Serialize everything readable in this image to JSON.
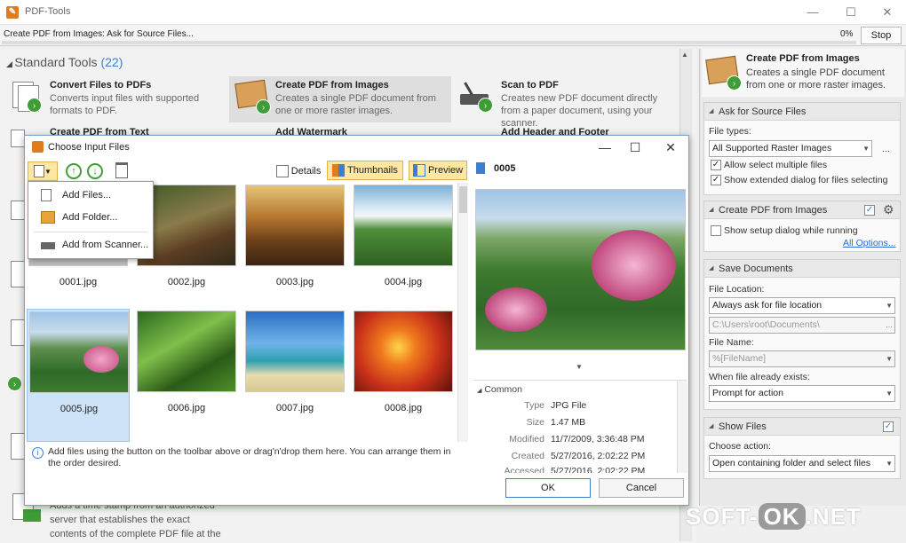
{
  "window": {
    "title": "PDF-Tools",
    "app_icon_glyph": "✎",
    "minimize": "—",
    "maximize": "☐",
    "close": "✕"
  },
  "progress": {
    "task": "Create PDF from Images: Ask for Source Files...",
    "percent": "0%",
    "value": 0,
    "stop_label": "Stop"
  },
  "tools": {
    "section_title": "Standard Tools",
    "count": "(22)",
    "items": [
      {
        "name": "Convert Files to PDFs",
        "desc": "Converts input files with supported formats to PDF."
      },
      {
        "name": "Create PDF from Images",
        "desc": "Creates a single PDF document from one or more raster images."
      },
      {
        "name": "Scan to PDF",
        "desc": "Creates new PDF document directly from a paper document, using your scanner."
      },
      {
        "name": "Create PDF from Text",
        "desc": ""
      },
      {
        "name": "Add Watermark",
        "desc": ""
      },
      {
        "name": "Add Header and Footer",
        "desc": ""
      }
    ],
    "bottom_desc": "Adds a time stamp from an authorized server that establishes the exact contents of the complete PDF file at the time the"
  },
  "right_panel": {
    "header_name": "Create PDF from Images",
    "header_desc": "Creates a single PDF document from one or more raster images.",
    "ask": {
      "title": "Ask for Source Files",
      "file_types_label": "File types:",
      "file_types_value": "All Supported Raster Images",
      "browse": "...",
      "allow_multiple": "Allow select multiple files",
      "extended_dialog": "Show extended dialog for files selecting"
    },
    "create": {
      "title": "Create PDF from Images",
      "show_setup": "Show setup dialog while running",
      "all_options": "All Options..."
    },
    "save": {
      "title": "Save Documents",
      "location_label": "File Location:",
      "location_value": "Always ask for file location",
      "path_value": "C:\\Users\\root\\Documents\\",
      "name_label": "File Name:",
      "name_value": "%[FileName]",
      "exists_label": "When file already exists:",
      "exists_value": "Prompt for action"
    },
    "show": {
      "title": "Show Files",
      "action_label": "Choose action:",
      "action_value": "Open containing folder and select files"
    }
  },
  "dialog": {
    "title": "Choose Input Files",
    "toolbar": {
      "details": "Details",
      "thumbnails": "Thumbnails",
      "preview": "Preview"
    },
    "menu": [
      "Add Files...",
      "Add Folder...",
      "Add from Scanner..."
    ],
    "files": [
      "0001.jpg",
      "0002.jpg",
      "0003.jpg",
      "0004.jpg",
      "0005.jpg",
      "0006.jpg",
      "0007.jpg",
      "0008.jpg"
    ],
    "selected_index": 4,
    "hint": "Add files using the button on the toolbar above or drag'n'drop them here. You can arrange them in the order desired.",
    "preview_name": "0005",
    "props_group": "Common",
    "props": [
      {
        "k": "Type",
        "v": "JPG File"
      },
      {
        "k": "Size",
        "v": "1.47 MB"
      },
      {
        "k": "Modified",
        "v": "11/7/2009, 3:36:48 PM"
      },
      {
        "k": "Created",
        "v": "5/27/2016, 2:02:22 PM"
      },
      {
        "k": "Accessed",
        "v": "5/27/2016, 2:02:22 PM"
      }
    ],
    "ok": "OK",
    "cancel": "Cancel"
  },
  "watermark": {
    "left": "SOFT-",
    "ok": "OK",
    "right": ".NET"
  },
  "colors": {
    "accent": "#3a7fd0",
    "green": "#3f9d36",
    "orange": "#e07b1f",
    "highlight": "#fde7a3"
  }
}
